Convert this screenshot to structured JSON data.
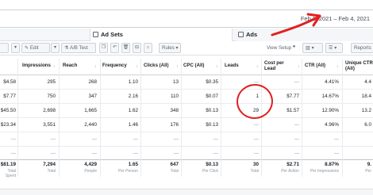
{
  "date_range": "Feb 1, 2021 – Feb 4, 2021",
  "tabs": {
    "adsets": "Ad Sets",
    "ads": "Ads"
  },
  "toolbar": {
    "edit": "Edit",
    "ab_test": "A/B Test",
    "rules": "Rules",
    "view_setup": "View Setup",
    "reports": "Reports"
  },
  "columns": {
    "impressions": "Impressions",
    "reach": "Reach",
    "frequency": "Frequency",
    "clicks": "Clicks (All)",
    "cpc": "CPC (All)",
    "leads": "Leads",
    "cost_per_lead_1": "Cost per",
    "cost_per_lead_2": "Lead",
    "ctr": "CTR (All)",
    "unique_ctr_1": "Unique CTR",
    "unique_ctr_2": "(All)"
  },
  "rows": [
    {
      "spent": "$4.58",
      "impressions": "295",
      "reach": "268",
      "frequency": "1.10",
      "clicks": "13",
      "cpc": "$0.35",
      "leads": "—",
      "cpl": "—",
      "ctr": "4.41%",
      "uctr": "4.4"
    },
    {
      "spent": "$7.77",
      "impressions": "750",
      "reach": "347",
      "frequency": "2.16",
      "clicks": "110",
      "cpc": "$0.07",
      "leads": "1",
      "cpl": "$7.77",
      "ctr": "14.67%",
      "uctr": "18.4"
    },
    {
      "spent": "$45.50",
      "impressions": "2,698",
      "reach": "1,665",
      "frequency": "1.62",
      "clicks": "348",
      "cpc": "$0.13",
      "leads": "29",
      "cpl": "$1.57",
      "ctr": "12.90%",
      "uctr": "13.2"
    },
    {
      "spent": "$23.34",
      "impressions": "3,551",
      "reach": "2,440",
      "frequency": "1.46",
      "clicks": "176",
      "cpc": "$0.13",
      "leads": "—",
      "cpl": "—",
      "ctr": "4.96%",
      "uctr": "6.0"
    },
    {
      "spent": "—",
      "impressions": "—",
      "reach": "—",
      "frequency": "—",
      "clicks": "—",
      "cpc": "—",
      "leads": "—",
      "cpl": "—",
      "ctr": "—",
      "uctr": ""
    },
    {
      "spent": "—",
      "impressions": "—",
      "reach": "—",
      "frequency": "—",
      "clicks": "—",
      "cpc": "—",
      "leads": "—",
      "cpl": "—",
      "ctr": "—",
      "uctr": ""
    }
  ],
  "totals": {
    "spent": "$81.19",
    "spent_lbl": "Total Spent",
    "impressions": "7,294",
    "impressions_lbl": "Total",
    "reach": "4,429",
    "reach_lbl": "People",
    "frequency": "1.65",
    "frequency_lbl": "Per Person",
    "clicks": "647",
    "clicks_lbl": "Total",
    "cpc": "$0.13",
    "cpc_lbl": "Per Click",
    "leads": "30",
    "leads_lbl": "Total",
    "cpl": "$2.71",
    "cpl_lbl": "Per Action",
    "ctr": "8.87%",
    "ctr_lbl": "Per Impressions",
    "uctr": "9.",
    "uctr_lbl": "Per"
  },
  "accent": "#e02020"
}
